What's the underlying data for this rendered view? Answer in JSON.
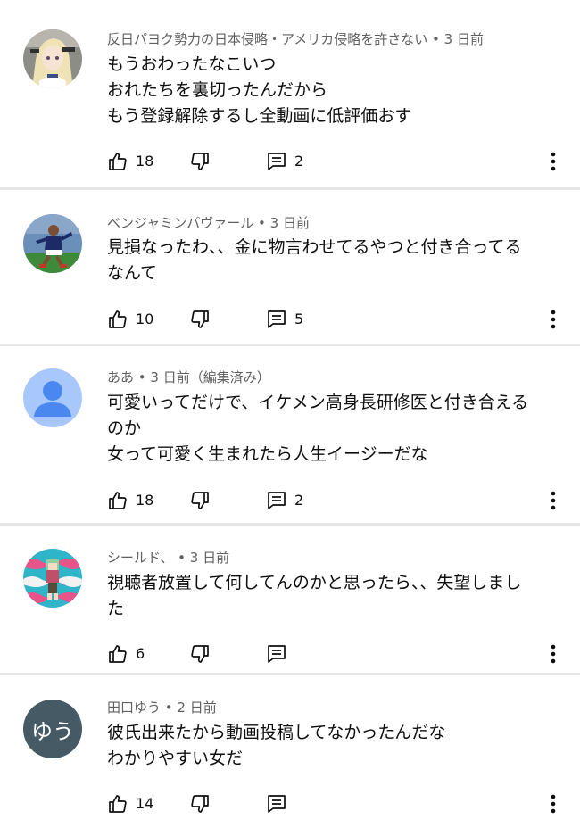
{
  "comments": [
    {
      "author": "反日パヨク勢力の日本侵略・アメリカ侵略を許さない",
      "time": "3 日前",
      "lines": [
        "もうおわったなこいつ",
        "おれたちを裏切ったんだから",
        "もう登録解除するし全動画に低評価おす"
      ],
      "likes": "18",
      "replies": "2",
      "avatar_icon": "anime-character-avatar"
    },
    {
      "author": "ベンジャミンパヴァール",
      "time": "3 日前",
      "lines": [
        "見損なったわ、、金に物言わせてるやつと付き合ってる",
        "なんて"
      ],
      "likes": "10",
      "replies": "5",
      "avatar_icon": "soccer-player-avatar"
    },
    {
      "author": "ああ",
      "time": "3 日前（編集済み）",
      "lines": [
        "可愛いってだけで、イケメン高身長研修医と付き合える",
        "のか",
        "女って可愛く生まれたら人生イージーだな"
      ],
      "likes": "18",
      "replies": "2",
      "avatar_icon": "default-person-avatar"
    },
    {
      "author": "シールド、",
      "time": "3 日前",
      "lines": [
        "視聴者放置して何してんのかと思ったら、、失望しまし",
        "た"
      ],
      "likes": "6",
      "replies": "",
      "avatar_icon": "pixel-character-avatar"
    },
    {
      "author": "田口ゆう",
      "time": "2 日前",
      "lines": [
        "彼氏出来たから動画投稿してなかったんだな",
        "わかりやすい女だ"
      ],
      "likes": "14",
      "replies": "",
      "avatar_icon": "initial-avatar",
      "avatar_text": "ゆう"
    }
  ],
  "separator": " • ",
  "colors": {
    "meta": "#606060",
    "text": "#0f0f0f",
    "separator": "#e6e6e6",
    "default_avatar_bg": "#a8c7fa",
    "default_avatar_fg": "#4a88f0",
    "initial_avatar_bg": "#455a64"
  }
}
